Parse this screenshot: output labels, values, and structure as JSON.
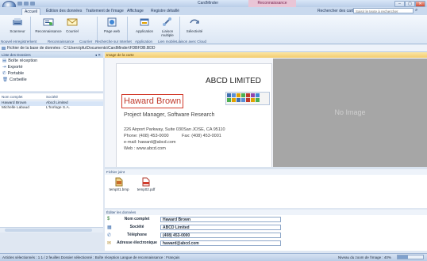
{
  "window": {
    "title": "CardMinder",
    "context_title": "Reconnaissance",
    "min": "–",
    "max": "▢",
    "close": "✕"
  },
  "tabs": [
    "Accueil",
    "Édition des données",
    "Traitement de l'image",
    "Affichage",
    "Registre détaillé"
  ],
  "search": {
    "label": "Rechercher des cartes",
    "placeholder": "Saisir le texte à rechercher"
  },
  "ribbon": {
    "buttons": [
      {
        "label": "Scanneur",
        "icon": "scanner-icon"
      },
      {
        "label": "Reconnaissance",
        "icon": "recognize-icon"
      },
      {
        "label": "Courriel",
        "icon": "email-icon"
      },
      {
        "label": "Page web",
        "icon": "webpage-icon"
      },
      {
        "label": "Application",
        "icon": "application-icon"
      },
      {
        "label": "Liaison multiple",
        "icon": "link-icon"
      },
      {
        "label": "Sélectivité",
        "icon": "select-icon"
      }
    ],
    "groups": [
      "Nouvel enregistrement",
      "Reconnaissance",
      "Courrier",
      "Recherche sur Internet",
      "Application",
      "Lien mobile",
      "Liaison avec Cloud"
    ]
  },
  "path": "Fichier de la base de données : C:\\Users\\pfu\\Documents\\CardMinder\\FDBFDB.BDD",
  "left": {
    "header": "Liste des Dossiers",
    "folders": [
      "Boîte réception",
      "Exporté",
      "Portable",
      "Corbeille"
    ],
    "columns": [
      "Nom complet",
      "Société"
    ],
    "contacts": [
      {
        "name": "Haward Brown",
        "company": "Abcd Limited"
      },
      {
        "name": "Michelle Labaud",
        "company": "L'horloge S.A."
      }
    ]
  },
  "image": {
    "header": "Image de la carte",
    "no_image": "No Image",
    "card": {
      "company": "ABCD LIMITED",
      "name": "Haward Brown",
      "title": "Project Manager, Software Research",
      "address": "226 Airport Parkway, Suite 030San JOSE, CA 95110",
      "phone": "Phone: (408) 453-0000",
      "fax": "Fax: (408) 453-0001",
      "email": "e-mail: haward@abcd.com",
      "web": "Web : www.abcd.com"
    }
  },
  "attachments": {
    "header": "Fichier joint",
    "files": [
      "temp01.bmp",
      "temp02.pdf"
    ]
  },
  "edit": {
    "header": "Éditer les données",
    "fields": [
      {
        "label": "Nom complet",
        "value": "Haward Brown"
      },
      {
        "label": "Société",
        "value": "ABCD Limited"
      },
      {
        "label": "Téléphone",
        "value": "(408) 453-0000"
      },
      {
        "label": "Adresse électronique",
        "value": "haward@abcd.com"
      }
    ]
  },
  "status": {
    "left": "Articles sélectionnés : 1    1 / 2 feuilles    Dossier sélectionné : Boîte réception    Langue de reconnaissance : Français",
    "zoom": "Niveau du zoom de l'image : 40%",
    "zoom_level": 0.4
  },
  "colors": {
    "accent": "#2f5690",
    "highlight": "#f3cc6e",
    "no_image_bg": "#a6a6a6",
    "name_red": "#c0392b"
  }
}
